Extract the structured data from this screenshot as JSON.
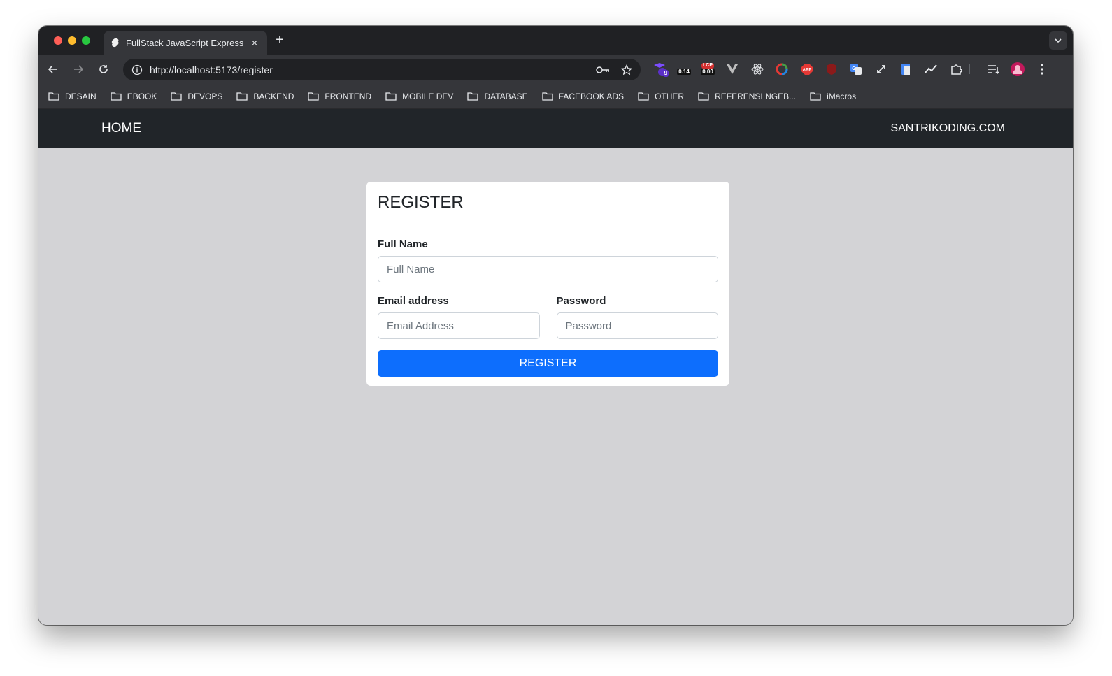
{
  "browser": {
    "tab_title": "FullStack JavaScript Express",
    "tab_close": "×",
    "new_tab": "+",
    "url": "http://localhost:5173/register",
    "extension_badges": {
      "counter": "9",
      "cls": "0.14",
      "lcp_label": "LCP",
      "lcp": "0.00"
    },
    "bookmarks": [
      "DESAIN",
      "EBOOK",
      "DEVOPS",
      "BACKEND",
      "FRONTEND",
      "MOBILE DEV",
      "DATABASE",
      "FACEBOOK ADS",
      "OTHER",
      "REFERENSI NGEB...",
      "iMacros"
    ]
  },
  "navbar": {
    "home": "HOME",
    "brand": "SANTRIKODING.COM"
  },
  "form": {
    "title": "REGISTER",
    "full_name_label": "Full Name",
    "full_name_placeholder": "Full Name",
    "email_label": "Email address",
    "email_placeholder": "Email Address",
    "password_label": "Password",
    "password_placeholder": "Password",
    "submit": "REGISTER"
  },
  "colors": {
    "navbar": "#212529",
    "primary": "#0d6efd",
    "page_bg": "#d3d3d6"
  }
}
